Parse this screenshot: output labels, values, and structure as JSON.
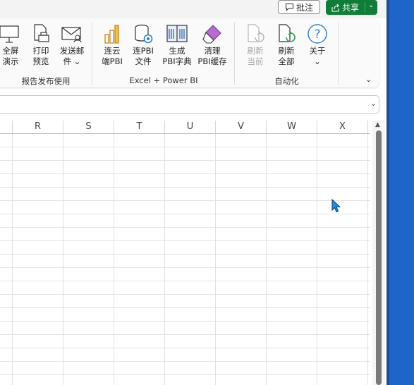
{
  "title_bar": {
    "comment_label": "批注",
    "share_label": "共享"
  },
  "ribbon": {
    "groups": [
      {
        "label": "报告发布使用",
        "buttons": [
          {
            "line1": "全屏",
            "line2": "演示",
            "icon": "fullscreen-icon"
          },
          {
            "line1": "打印",
            "line2": "预览",
            "icon": "print-preview-icon"
          },
          {
            "line1": "发送邮",
            "line2": "件 ⌄",
            "icon": "mail-icon"
          }
        ]
      },
      {
        "label": "Excel + Power BI",
        "buttons": [
          {
            "line1": "连云",
            "line2": "端PBI",
            "icon": "cloud-pbi-icon"
          },
          {
            "line1": "连PBI",
            "line2": "文件",
            "icon": "pbi-file-icon"
          },
          {
            "line1": "生成",
            "line2": "PBI字典",
            "icon": "dictionary-icon"
          },
          {
            "line1": "清理",
            "line2": "PBI缓存",
            "icon": "eraser-icon"
          }
        ]
      },
      {
        "label": "自动化",
        "buttons": [
          {
            "line1": "刷新",
            "line2": "当前",
            "icon": "refresh-current-icon",
            "disabled": true
          },
          {
            "line1": "刷新",
            "line2": "全部",
            "icon": "refresh-all-icon"
          },
          {
            "line1": "关于",
            "line2": "⌄",
            "icon": "help-icon"
          }
        ]
      }
    ]
  },
  "sheet": {
    "columns": [
      "R",
      "S",
      "T",
      "U",
      "V",
      "W",
      "X"
    ]
  },
  "colors": {
    "share_green": "#117c38",
    "desktop_blue": "#1f64c8",
    "cursor_blue": "#1f8fe0"
  }
}
